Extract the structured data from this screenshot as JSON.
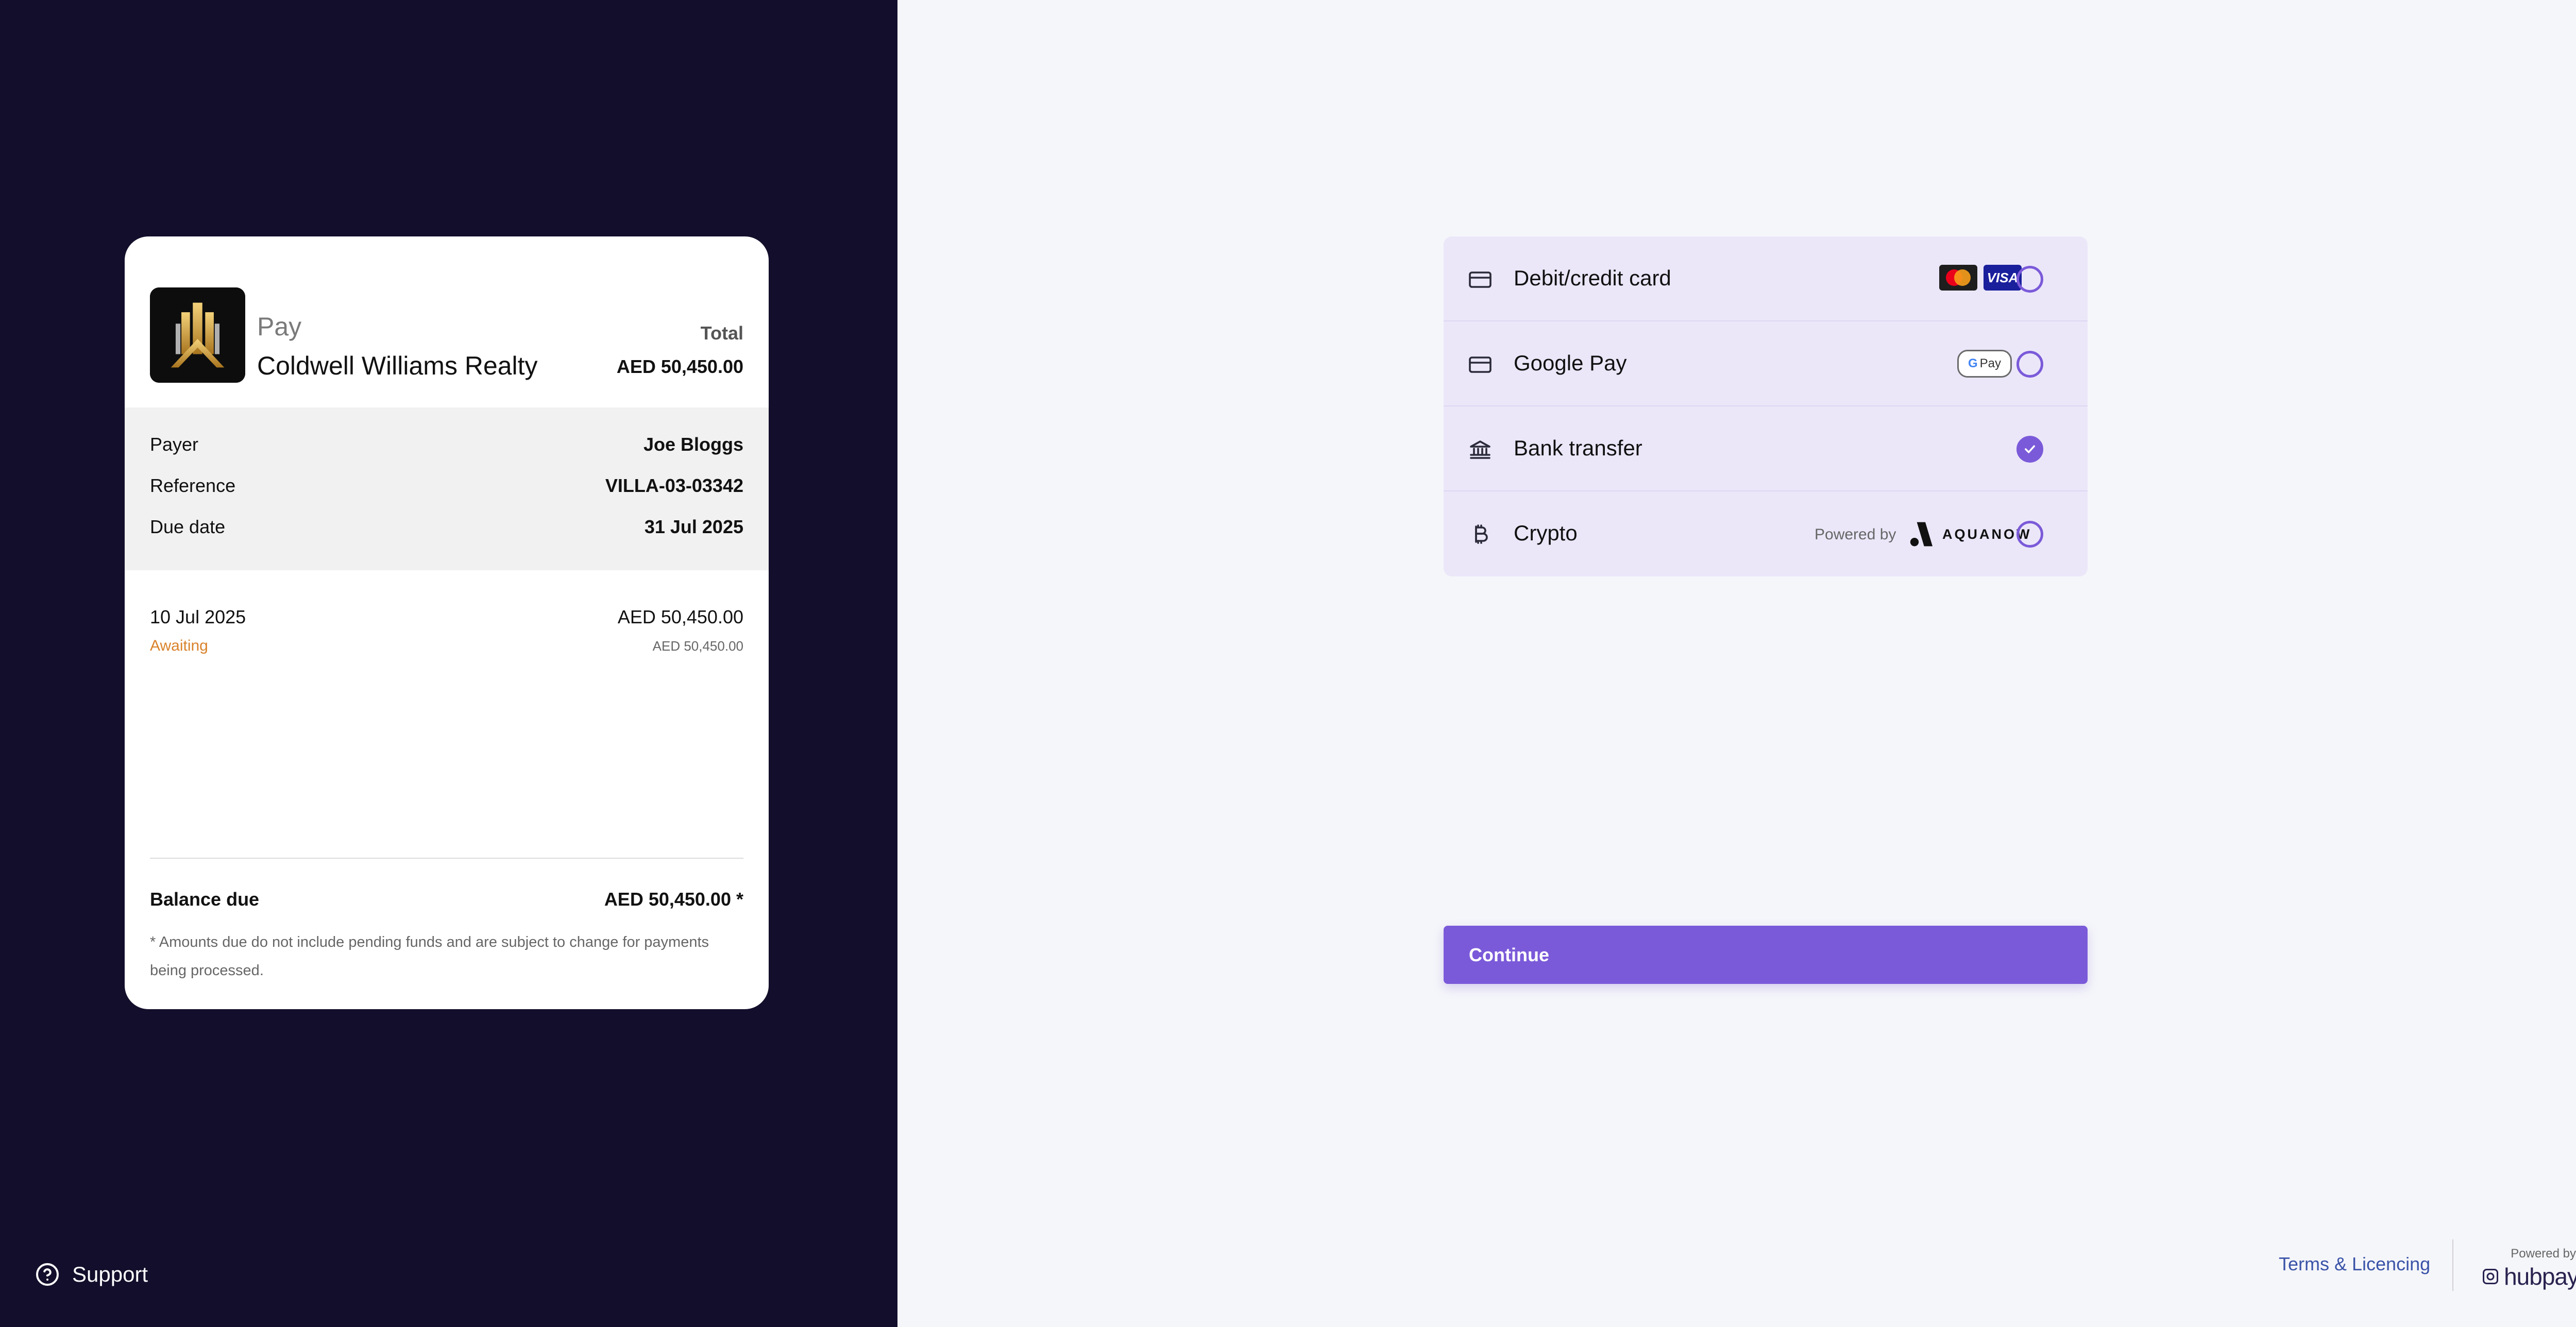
{
  "summary": {
    "pay_label": "Pay",
    "merchant_name": "Coldwell Williams Realty",
    "total_label": "Total",
    "total_amount": "AED 50,450.00",
    "details": [
      {
        "label": "Payer",
        "value": "Joe Bloggs"
      },
      {
        "label": "Reference",
        "value": "VILLA-03-03342"
      },
      {
        "label": "Due date",
        "value": "31 Jul 2025"
      }
    ],
    "entry": {
      "date": "10 Jul 2025",
      "status": "Awaiting",
      "amount": "AED 50,450.00",
      "sub_amount": "AED 50,450.00"
    },
    "balance_label": "Balance due",
    "balance_amount": "AED 50,450.00 *",
    "note": "* Amounts due do not include pending funds and are subject to change for payments being processed."
  },
  "support": {
    "label": "Support",
    "icon": "help-circle-icon"
  },
  "payment_methods": [
    {
      "label": "Debit/credit card",
      "icon": "credit-card-icon",
      "badges": [
        "mastercard-logo",
        "visa-logo"
      ],
      "selected": false
    },
    {
      "label": "Google Pay",
      "icon": "credit-card-icon",
      "badge": "google-pay-badge",
      "selected": false
    },
    {
      "label": "Bank transfer",
      "icon": "bank-icon",
      "selected": true
    },
    {
      "label": "Crypto",
      "icon": "bitcoin-icon",
      "powered_by": "Powered by",
      "partner": "AQUANOW",
      "selected": false
    }
  ],
  "badges": {
    "visa": "VISA",
    "gpay_g": "G",
    "gpay_text": "Pay"
  },
  "continue_label": "Continue",
  "footer": {
    "terms_label": "Terms & Licencing",
    "powered_by": "Powered by",
    "brand": "hubpay"
  },
  "colors": {
    "sidebar_bg": "#130e2b",
    "accent": "#7b5ad9",
    "methods_bg": "#ebe7f9",
    "status_awaiting": "#d9822b",
    "link": "#3a53a8"
  }
}
